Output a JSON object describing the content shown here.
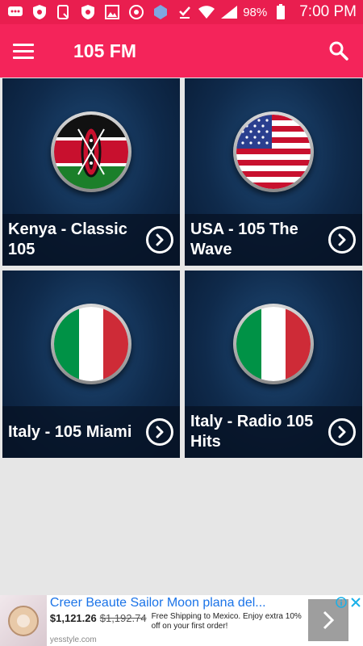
{
  "status_bar": {
    "icons": [
      "chat-icon",
      "vpn-shield-icon",
      "screenshot-icon",
      "vpn-shield-icon",
      "gallery-icon",
      "chrome-icon",
      "vpn-badge-icon",
      "download-done-icon"
    ],
    "battery_percent": "98%",
    "time": "7:00 PM"
  },
  "app_bar": {
    "title": "105 FM",
    "menu_icon": "menu-icon",
    "search_icon": "search-icon"
  },
  "stations": [
    {
      "name": "Kenya - Classic 105",
      "flag": "kenya"
    },
    {
      "name": "USA - 105 The Wave",
      "flag": "usa"
    },
    {
      "name": "Italy - 105 Miami",
      "flag": "italy"
    },
    {
      "name": "Italy - Radio 105 Hits",
      "flag": "italy"
    }
  ],
  "ad": {
    "title": "Creer Beaute Sailor Moon plana del...",
    "price": "$1,121.26",
    "old_price": "$1,192.74",
    "description": "Free Shipping to Mexico. Enjoy extra 10% off on your first order!",
    "domain": "yesstyle.com"
  },
  "colors": {
    "status_bar": "#e91e4f",
    "app_bar": "#f4245a",
    "card_background": "#0f2a4b",
    "page_background": "#e6e6e6"
  }
}
